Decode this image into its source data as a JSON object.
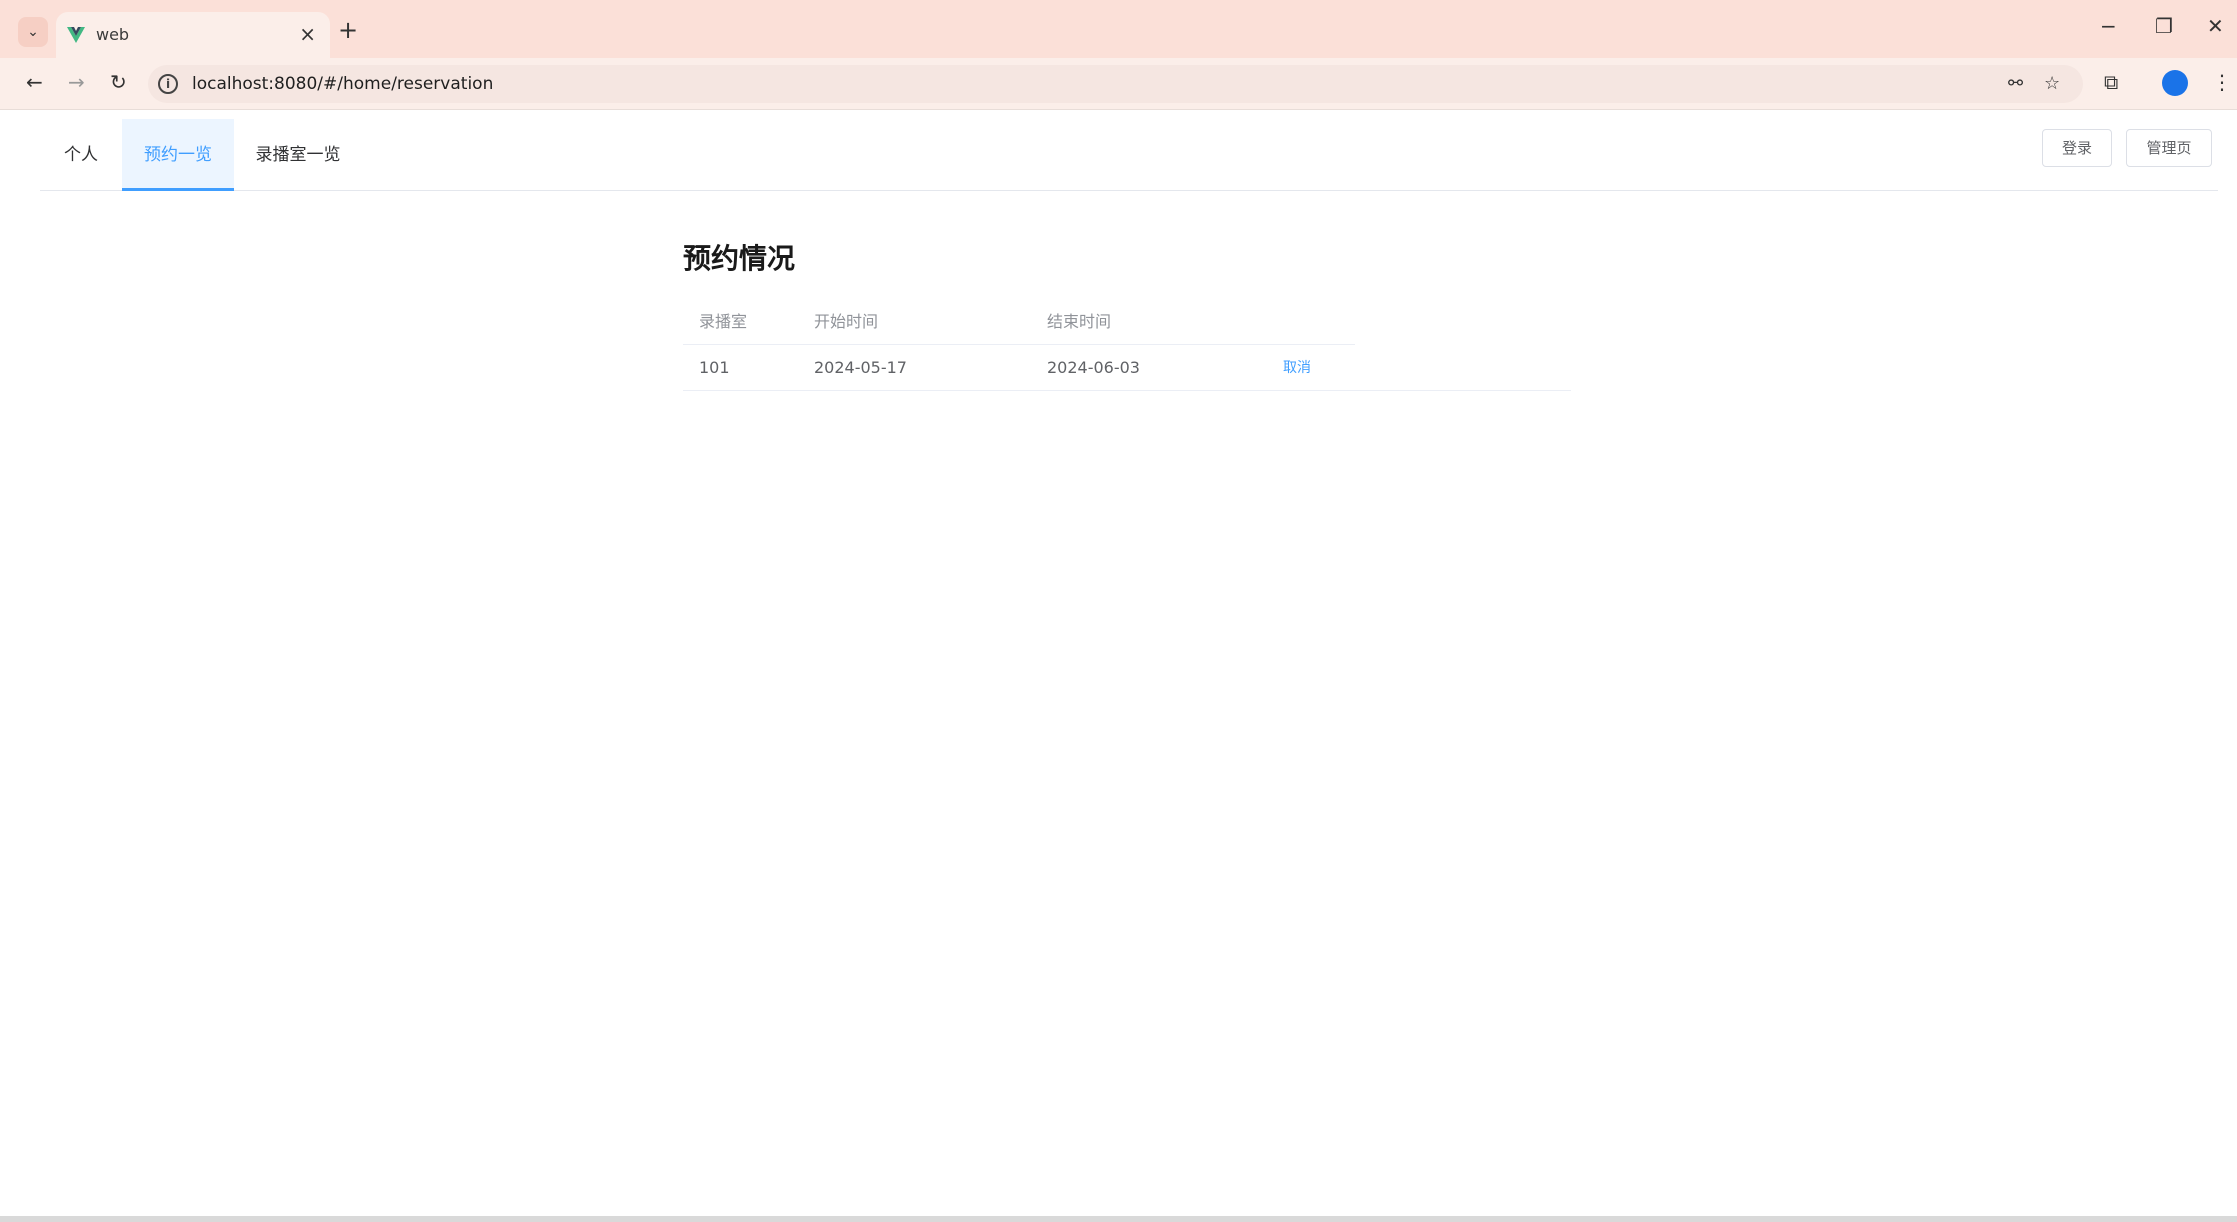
{
  "browser": {
    "tab_title": "web",
    "tab_close": "×",
    "new_tab": "+",
    "tab_list_icon": "chevron-down-icon",
    "url": "localhost:8080/#/home/reservation",
    "window_controls": {
      "minimize": "−",
      "restore": "❐",
      "close": "✕"
    },
    "nav": {
      "back": "←",
      "forward": "→",
      "reload": "↻"
    },
    "toolbar_icons": {
      "password": "⚯",
      "star": "☆",
      "extensions": "⧉",
      "menu": "⋮"
    }
  },
  "menu": {
    "items": [
      {
        "label": "个人"
      },
      {
        "label": "预约一览",
        "active": true
      },
      {
        "label": "录播室一览"
      }
    ],
    "login_label": "登录",
    "admin_label": "管理页"
  },
  "main": {
    "title": "预约情况",
    "columns": [
      "录播室",
      "开始时间",
      "结束时间"
    ],
    "rows": [
      {
        "room": "101",
        "start": "2024-05-17",
        "end": "2024-06-03",
        "action": "取消"
      }
    ]
  },
  "colors": {
    "accent": "#409eff",
    "chrome_tab_bg": "#fbe0d8",
    "active_menu_bg": "#ecf5ff"
  }
}
